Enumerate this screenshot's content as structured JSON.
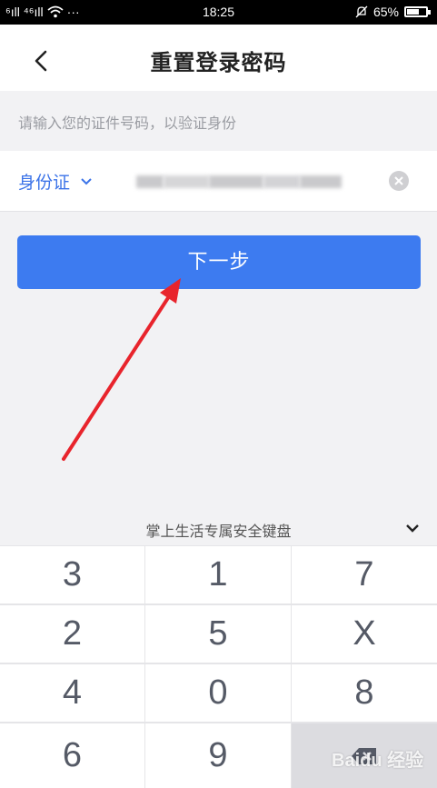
{
  "status_bar": {
    "signal": "⁶ıll ⁴⁶ıll",
    "time": "18:25",
    "battery_text": "65%",
    "battery_level": 0.65
  },
  "header": {
    "title": "重置登录密码",
    "back_icon": "chevron-left-icon"
  },
  "form": {
    "hint": "请输入您的证件号码，以验证身份",
    "id_type_label": "身份证",
    "id_type_icon": "chevron-down-icon",
    "clear_icon": "clear-icon"
  },
  "next_button_label": "下一步",
  "keyboard": {
    "title": "掌上生活专属安全键盘",
    "collapse_icon": "chevron-down-icon",
    "keys": [
      [
        "3",
        "1",
        "7"
      ],
      [
        "2",
        "5",
        "X"
      ],
      [
        "4",
        "0",
        "8"
      ],
      [
        "6",
        "9",
        ""
      ]
    ],
    "delete_icon": "backspace-icon"
  },
  "colors": {
    "accent": "#3d7bf0",
    "link_blue": "#3b73e8",
    "annotation_arrow": "#e8242c"
  },
  "watermark": "Baidu 经验"
}
